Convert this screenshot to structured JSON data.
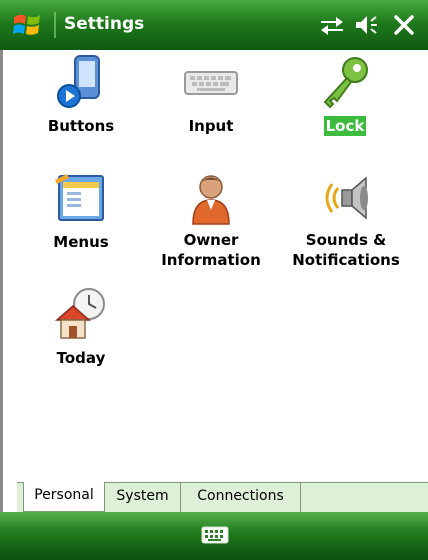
{
  "titlebar": {
    "title": "Settings"
  },
  "items": [
    {
      "label": "Buttons",
      "icon": "buttons-icon"
    },
    {
      "label": "Input",
      "icon": "keyboard-input-icon"
    },
    {
      "label": "Lock",
      "icon": "key-lock-icon",
      "selected": true
    },
    {
      "label": "Menus",
      "icon": "menus-icon"
    },
    {
      "label": "Owner\nInformation",
      "icon": "owner-person-icon"
    },
    {
      "label": "Sounds &\nNotifications",
      "icon": "speaker-sound-icon"
    },
    {
      "label": "Today",
      "icon": "today-house-clock-icon"
    }
  ],
  "tabs": {
    "personal": "Personal",
    "system": "System",
    "connections": "Connections"
  },
  "colors": {
    "titlebar_green": "#1f7a1c",
    "selection_green": "#3dbb3d",
    "tab_strip": "#dff0d8"
  }
}
